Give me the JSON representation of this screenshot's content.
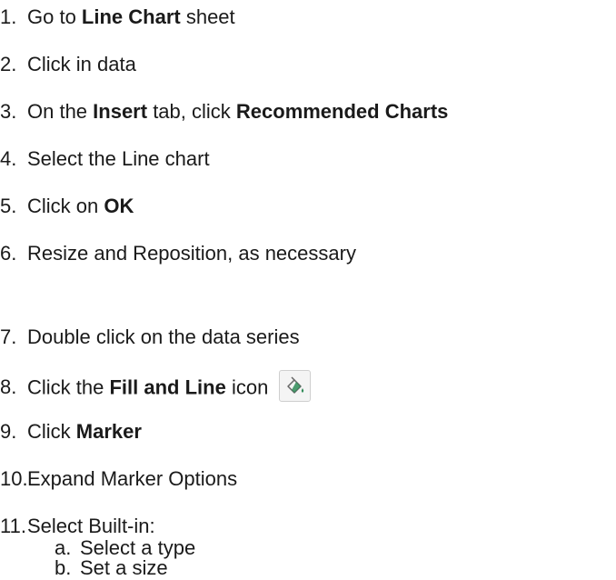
{
  "steps": [
    {
      "num": "1.",
      "parts": [
        {
          "t": "Go to ",
          "b": false
        },
        {
          "t": "Line Chart",
          "b": true
        },
        {
          "t": " sheet",
          "b": false
        }
      ]
    },
    {
      "num": "2.",
      "parts": [
        {
          "t": "Click in data",
          "b": false
        }
      ]
    },
    {
      "num": "3.",
      "parts": [
        {
          "t": "On the ",
          "b": false
        },
        {
          "t": "Insert",
          "b": true
        },
        {
          "t": " tab, click ",
          "b": false
        },
        {
          "t": "Recommended Charts",
          "b": true
        }
      ]
    },
    {
      "num": "4.",
      "parts": [
        {
          "t": "Select the Line chart",
          "b": false
        }
      ]
    },
    {
      "num": "5.",
      "parts": [
        {
          "t": "Click on ",
          "b": false
        },
        {
          "t": "OK",
          "b": true
        }
      ]
    },
    {
      "num": "6.",
      "parts": [
        {
          "t": "Resize and Reposition, as necessary",
          "b": false
        }
      ]
    },
    {
      "num": "7.",
      "parts": [
        {
          "t": "Double click on the data series",
          "b": false
        }
      ]
    },
    {
      "num": "8.",
      "parts": [
        {
          "t": "Click the ",
          "b": false
        },
        {
          "t": "Fill and Line",
          "b": true
        },
        {
          "t": " icon",
          "b": false
        }
      ],
      "icon": "fill-and-line-icon"
    },
    {
      "num": "9.",
      "parts": [
        {
          "t": "Click ",
          "b": false
        },
        {
          "t": "Marker",
          "b": true
        }
      ]
    },
    {
      "num": "10.",
      "parts": [
        {
          "t": "Expand Marker Options",
          "b": false
        }
      ]
    },
    {
      "num": "11.",
      "parts": [
        {
          "t": "Select Built-in:",
          "b": false
        }
      ]
    }
  ],
  "substeps": [
    {
      "num": "a.",
      "text": "Select a type"
    },
    {
      "num": "b.",
      "text": "Set a size"
    }
  ],
  "colors": {
    "text": "#1a1a1a",
    "icon_accent": "#2e8b57"
  }
}
